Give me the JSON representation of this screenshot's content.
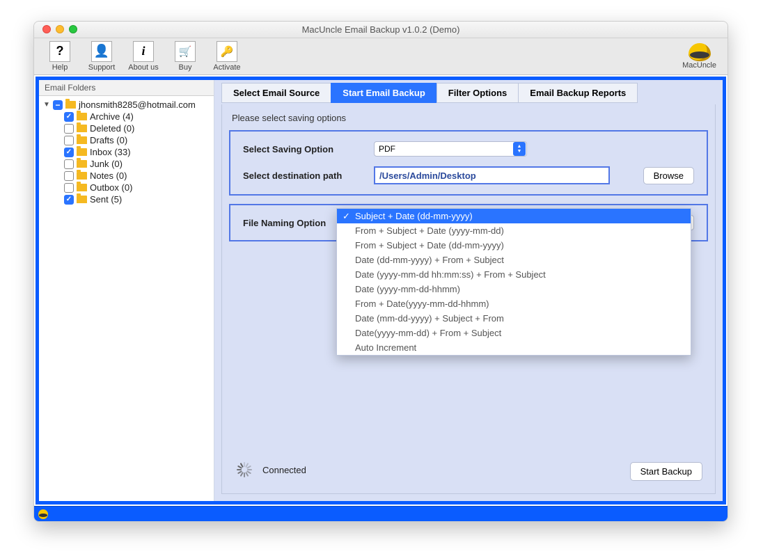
{
  "window_title": "MacUncle Email Backup v1.0.2 (Demo)",
  "brand": "MacUncle",
  "toolbar": [
    {
      "label": "Help",
      "icon": "?"
    },
    {
      "label": "Support",
      "icon": "👤"
    },
    {
      "label": "About us",
      "icon": "i"
    },
    {
      "label": "Buy",
      "icon": "🛒"
    },
    {
      "label": "Activate",
      "icon": "🔑"
    }
  ],
  "sidebar": {
    "header": "Email Folders",
    "account": "jhonsmith8285@hotmail.com",
    "folders": [
      {
        "name": "Archive",
        "count": 4,
        "checked": true
      },
      {
        "name": "Deleted",
        "count": 0,
        "checked": false
      },
      {
        "name": "Drafts",
        "count": 0,
        "checked": false
      },
      {
        "name": "Inbox",
        "count": 33,
        "checked": true
      },
      {
        "name": "Junk",
        "count": 0,
        "checked": false
      },
      {
        "name": "Notes",
        "count": 0,
        "checked": false
      },
      {
        "name": "Outbox",
        "count": 0,
        "checked": false
      },
      {
        "name": "Sent",
        "count": 5,
        "checked": true
      }
    ]
  },
  "tabs": [
    "Select Email Source",
    "Start Email Backup",
    "Filter Options",
    "Email Backup Reports"
  ],
  "active_tab": 1,
  "panel": {
    "intro": "Please select saving options",
    "saving_option_label": "Select Saving Option",
    "saving_option_value": "PDF",
    "dest_label": "Select destination path",
    "dest_value": "/Users/Admin/Desktop",
    "browse": "Browse",
    "naming_label": "File Naming Option",
    "naming_options": [
      "Subject + Date (dd-mm-yyyy)",
      "From + Subject + Date (yyyy-mm-dd)",
      "From + Subject + Date (dd-mm-yyyy)",
      "Date (dd-mm-yyyy) + From + Subject",
      "Date (yyyy-mm-dd hh:mm:ss) + From + Subject",
      "Date (yyyy-mm-dd-hhmm)",
      "From + Date(yyyy-mm-dd-hhmm)",
      "Date (mm-dd-yyyy) + Subject + From",
      "Date(yyyy-mm-dd) + From + Subject",
      "Auto Increment"
    ],
    "naming_selected_index": 0,
    "status": "Connected",
    "start_button": "Start Backup"
  }
}
